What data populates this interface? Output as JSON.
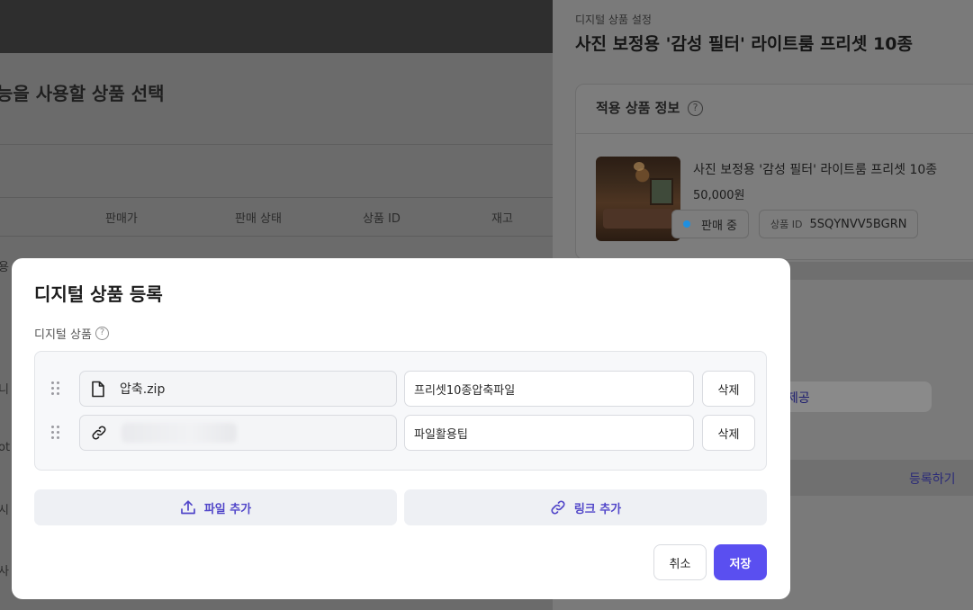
{
  "background_page": {
    "heading": "능을 사용할 상품 선택",
    "columns": [
      "판매가",
      "판매 상태",
      "상품 ID",
      "재고"
    ],
    "row_fragments": [
      "용",
      "니",
      "ot",
      "시",
      "사"
    ]
  },
  "side_panel": {
    "breadcrumb": "디지털 상품 설정",
    "title": "사진 보정용 '감성 필터' 라이트룸 프리셋 10종",
    "card_title": "적용 상품 정보",
    "product": {
      "name": "사진 보정용 '감성 필터' 라이트룸 프리셋 10종",
      "price": "50,000원",
      "status": "판매 중",
      "status_color": "#1f8fe0",
      "id_label": "상품 ID",
      "id_value": "5SQYNVV5BGRN"
    },
    "provide_fragment": "제공",
    "register_label": "등록하기"
  },
  "modal": {
    "title": "디지털 상품 등록",
    "section_label": "디지털 상품",
    "items": [
      {
        "icon": "file-icon",
        "name": "압축.zip",
        "description": "프리셋10종압축파일",
        "delete_label": "삭제"
      },
      {
        "icon": "link-icon",
        "name": "",
        "description": "파일활용팁",
        "delete_label": "삭제"
      }
    ],
    "add_file_label": "파일 추가",
    "add_link_label": "링크 추가",
    "cancel_label": "취소",
    "save_label": "저장",
    "accent_color": "#5a4ff0"
  }
}
